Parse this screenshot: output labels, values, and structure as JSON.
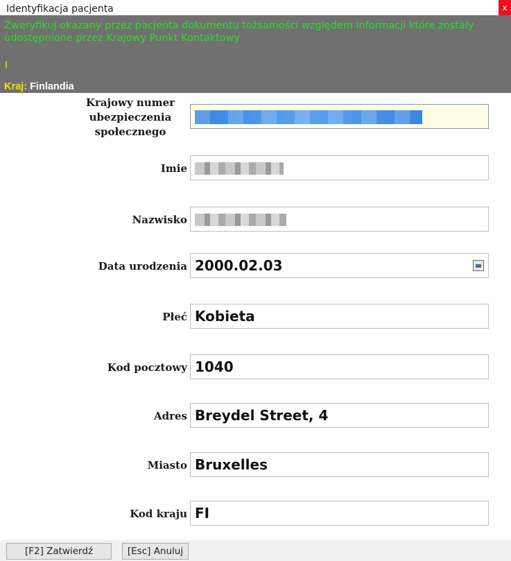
{
  "window": {
    "title": "Identyfikacja pacjenta",
    "close_label": "x"
  },
  "banner": {
    "message": "Zweryfikuj okazany przez pacjenta dokumentu tożsamości względem informacji które zostały udostępnione przez Krajowy Punkt Kontaktowy",
    "country_label": "Kraj:",
    "country_value": "Finlandia"
  },
  "fields": {
    "insurance_number_label": "Krajowy numer ubezpieczenia społecznego",
    "first_name_label": "Imie",
    "last_name_label": "Nazwisko",
    "birth_date_label": "Data urodzenia",
    "birth_date_value": "2000.02.03",
    "sex_label": "Płeć",
    "sex_value": "Kobieta",
    "postal_code_label": "Kod pocztowy",
    "postal_code_value": "1040",
    "address_label": "Adres",
    "address_value": "Breydel Street, 4",
    "city_label": "Miasto",
    "city_value": "Bruxelles",
    "country_code_label": "Kod kraju",
    "country_code_value": "FI"
  },
  "buttons": {
    "confirm_label": "[F2] Zatwierdź",
    "cancel_label": "[Esc] Anuluj"
  },
  "icons": {
    "calendar": "calendar-icon",
    "close": "close-icon"
  },
  "colors": {
    "banner_bg": "#707070",
    "banner_text": "#2bdc2b",
    "country_label": "#f4e200",
    "close_button": "#e81123"
  }
}
